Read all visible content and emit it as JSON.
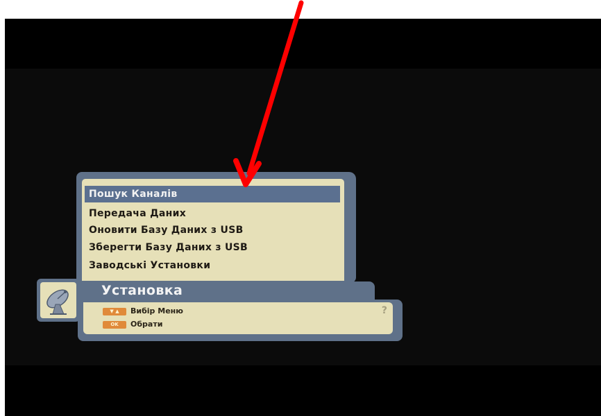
{
  "menu": {
    "items": [
      {
        "label": "Пошук Каналів",
        "selected": true
      },
      {
        "label": "Передача Даних",
        "selected": false
      },
      {
        "label": "Оновити Базу Даних з USB",
        "selected": false
      },
      {
        "label": "Зберегти Базу Даних з USB",
        "selected": false
      },
      {
        "label": "Заводські Установки",
        "selected": false
      }
    ]
  },
  "panel": {
    "title": "Установка",
    "icon": "satellite-dish-icon"
  },
  "help": {
    "select_key": "▼ ▲",
    "select_label": "Вибір Меню",
    "ok_key": "OK",
    "ok_label": "Обрати",
    "help_mark": "?"
  },
  "colors": {
    "panel_frame": "#5f7189",
    "panel_bg": "#e6e0b8",
    "selected_bg": "#5b7090",
    "key_orange": "#e08a3a",
    "arrow_red": "#ff0000"
  }
}
